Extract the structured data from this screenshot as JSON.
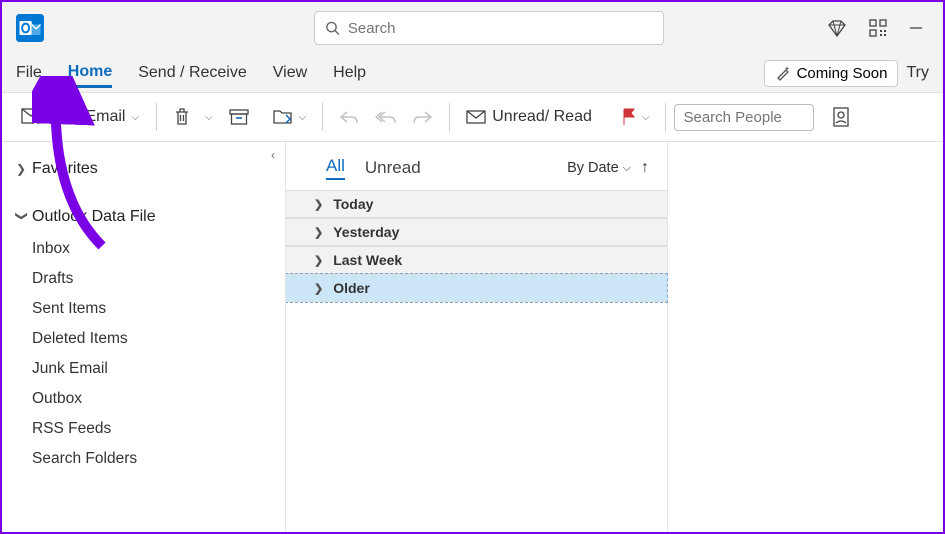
{
  "title": {
    "search_placeholder": "Search"
  },
  "menubar": {
    "file": "File",
    "home": "Home",
    "send_receive": "Send / Receive",
    "view": "View",
    "help": "Help",
    "coming_soon": "Coming Soon",
    "try": "Try"
  },
  "toolbar": {
    "new_email": "New Email",
    "unread_read": "Unread/ Read",
    "search_people_placeholder": "Search People"
  },
  "sidebar": {
    "favorites": "Favorites",
    "data_file": "Outlook Data File",
    "folders": [
      "Inbox",
      "Drafts",
      "Sent Items",
      "Deleted Items",
      "Junk Email",
      "Outbox",
      "RSS Feeds",
      "Search Folders"
    ]
  },
  "messages": {
    "tabs": {
      "all": "All",
      "unread": "Unread"
    },
    "sort": "By Date",
    "groups": [
      "Today",
      "Yesterday",
      "Last Week",
      "Older"
    ],
    "selected_index": 3
  }
}
